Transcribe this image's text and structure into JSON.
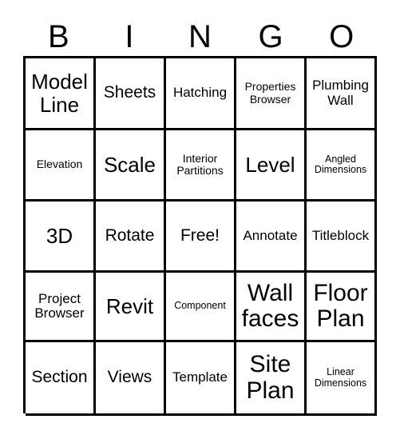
{
  "card": {
    "title_letters": [
      "B",
      "I",
      "N",
      "G",
      "O"
    ],
    "columns": 5,
    "rows": 5,
    "free_space_label": "Free!",
    "grid_color": "#000000",
    "background_color": "#ffffff",
    "text_color": "#000000",
    "cells": [
      [
        {
          "text": "Model\nLine",
          "size": "lg"
        },
        {
          "text": "Sheets",
          "size": "md"
        },
        {
          "text": "Hatching",
          "size": "sm"
        },
        {
          "text": "Properties\nBrowser",
          "size": "xs"
        },
        {
          "text": "Plumbing\nWall",
          "size": "sm"
        }
      ],
      [
        {
          "text": "Elevation",
          "size": "xs"
        },
        {
          "text": "Scale",
          "size": "lg"
        },
        {
          "text": "Interior\nPartitions",
          "size": "xs"
        },
        {
          "text": "Level",
          "size": "lg"
        },
        {
          "text": "Angled\nDimensions",
          "size": "xxs"
        }
      ],
      [
        {
          "text": "3D",
          "size": "lg"
        },
        {
          "text": "Rotate",
          "size": "md"
        },
        {
          "text": "Free!",
          "size": "md"
        },
        {
          "text": "Annotate",
          "size": "sm"
        },
        {
          "text": "Titleblock",
          "size": "sm"
        }
      ],
      [
        {
          "text": "Project\nBrowser",
          "size": "sm"
        },
        {
          "text": "Revit",
          "size": "lg"
        },
        {
          "text": "Component",
          "size": "xxs"
        },
        {
          "text": "Wall\nfaces",
          "size": "xl"
        },
        {
          "text": "Floor\nPlan",
          "size": "xl"
        }
      ],
      [
        {
          "text": "Section",
          "size": "md"
        },
        {
          "text": "Views",
          "size": "md"
        },
        {
          "text": "Template",
          "size": "sm"
        },
        {
          "text": "Site\nPlan",
          "size": "xl"
        },
        {
          "text": "Linear\nDimensions",
          "size": "xxs"
        }
      ]
    ]
  }
}
